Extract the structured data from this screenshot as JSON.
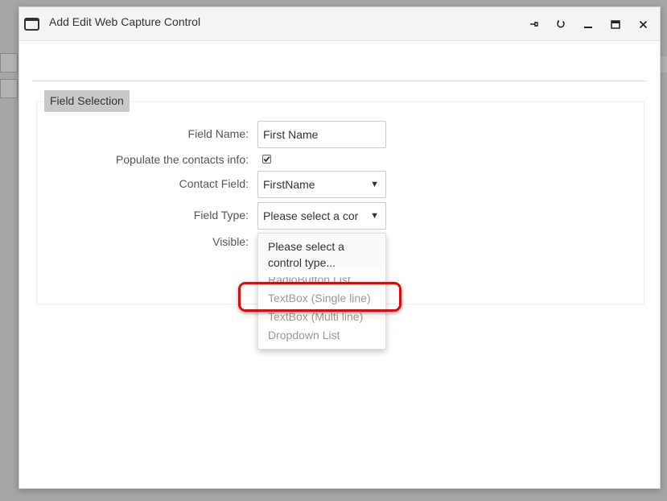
{
  "window": {
    "title": "Add Edit Web Capture Control"
  },
  "section": {
    "legend": "Field Selection"
  },
  "form": {
    "field_name_label": "Field Name:",
    "field_name_value": "First Name",
    "populate_label": "Populate the contacts info:",
    "populate_checked": true,
    "contact_field_label": "Contact Field:",
    "contact_field_value": "FirstName",
    "field_type_label": "Field Type:",
    "field_type_value": "Please select a cor",
    "visible_label": "Visible:"
  },
  "dropdown": {
    "options": [
      "Please select a control type...",
      "RadioButton List",
      "TextBox (Single line)",
      "TextBox (Multi line)",
      "Dropdown List"
    ]
  },
  "colors": {
    "highlight": "#d40f0f",
    "legend_bg": "#c9c9c9"
  },
  "icons": {
    "window": "window-icon",
    "pin": "pin-icon",
    "refresh": "refresh-icon",
    "minimize": "minimize-icon",
    "maximize": "maximize-icon",
    "close": "close-icon",
    "dropdown_arrow": "chevron-down-icon",
    "check": "checkmark-icon"
  }
}
